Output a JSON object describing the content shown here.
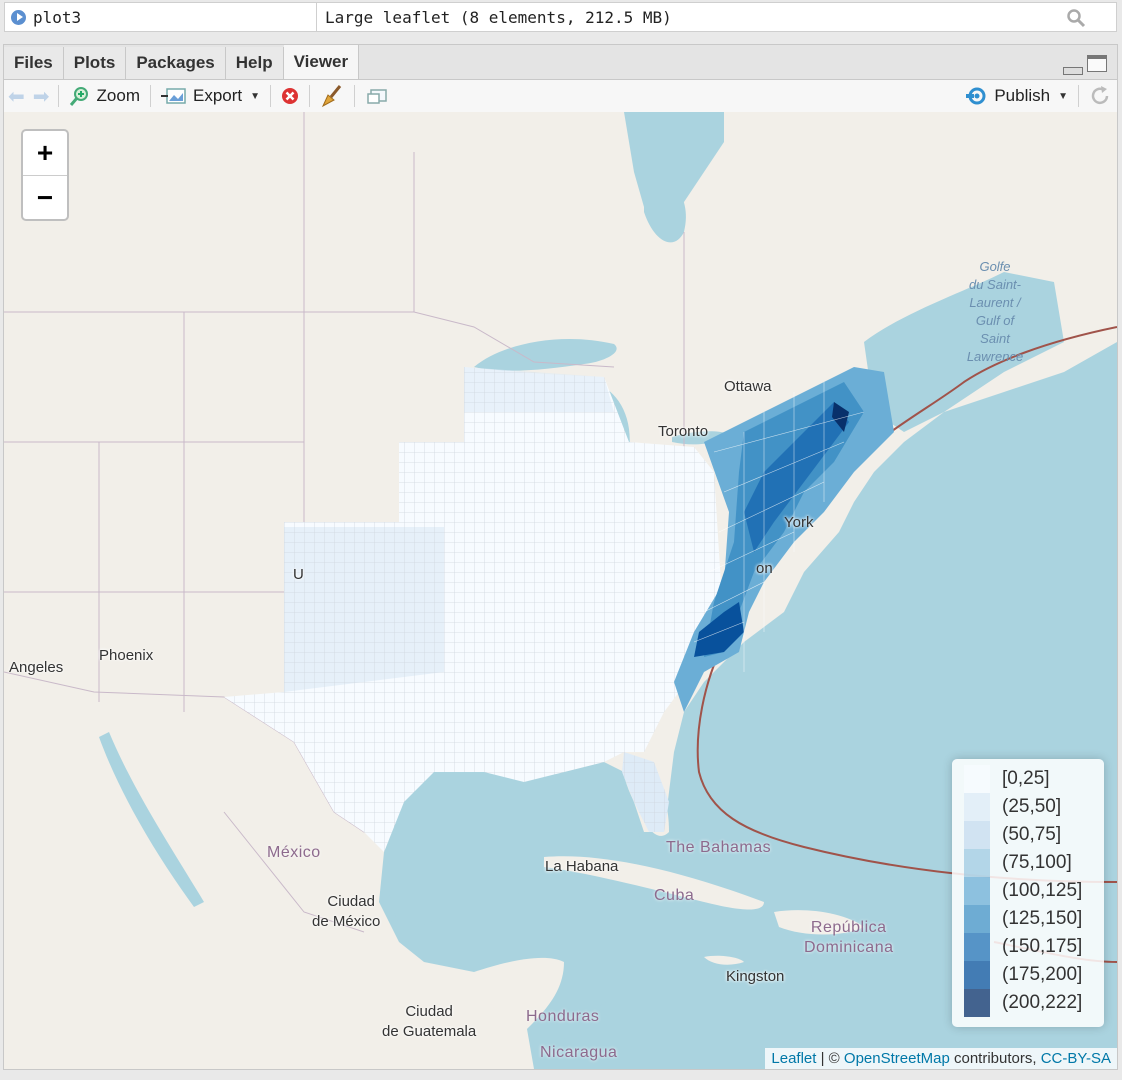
{
  "environment": {
    "object_name": "plot3",
    "object_value": "Large leaflet (8 elements, 212.5 MB)"
  },
  "tabs": [
    "Files",
    "Plots",
    "Packages",
    "Help",
    "Viewer"
  ],
  "active_tab": "Viewer",
  "toolbar": {
    "zoom_label": "Zoom",
    "export_label": "Export",
    "publish_label": "Publish"
  },
  "map": {
    "zoom_in": "+",
    "zoom_out": "−",
    "places": {
      "ottawa": "Ottawa",
      "toronto": "Toronto",
      "york": "York",
      "on": "on",
      "phoenix": "Phoenix",
      "angeles": "Angeles",
      "mexico": "México",
      "ciudad_mexico_1": "Ciudad",
      "ciudad_mexico_2": "de México",
      "la_habana": "La Habana",
      "bahamas": "The Bahamas",
      "cuba": "Cuba",
      "republica_1": "República",
      "republica_2": "Dominicana",
      "kingston": "Kingston",
      "guatemala_1": "Ciudad",
      "guatemala_2": "de Guatemala",
      "honduras": "Honduras",
      "nicaragua": "Nicaragua",
      "u": "U"
    },
    "gulf_label": [
      "Golfe",
      "du Saint-",
      "Laurent /",
      "Gulf of",
      "Saint",
      "Lawrence"
    ]
  },
  "legend": {
    "bins": [
      {
        "label": "[0,25]",
        "color": "#f7fbff"
      },
      {
        "label": "(25,50]",
        "color": "#deebf7"
      },
      {
        "label": "(50,75]",
        "color": "#c6dbef"
      },
      {
        "label": "(75,100]",
        "color": "#9ecae1"
      },
      {
        "label": "(100,125]",
        "color": "#6baed6"
      },
      {
        "label": "(125,150]",
        "color": "#4292c6"
      },
      {
        "label": "(150,175]",
        "color": "#2171b5"
      },
      {
        "label": "(175,200]",
        "color": "#08519c"
      },
      {
        "label": "(200,222]",
        "color": "#08306b"
      }
    ]
  },
  "attribution": {
    "leaflet": "Leaflet",
    "separator": " | © ",
    "osm": "OpenStreetMap",
    "contributors": " contributors, ",
    "license": "CC-BY-SA"
  }
}
